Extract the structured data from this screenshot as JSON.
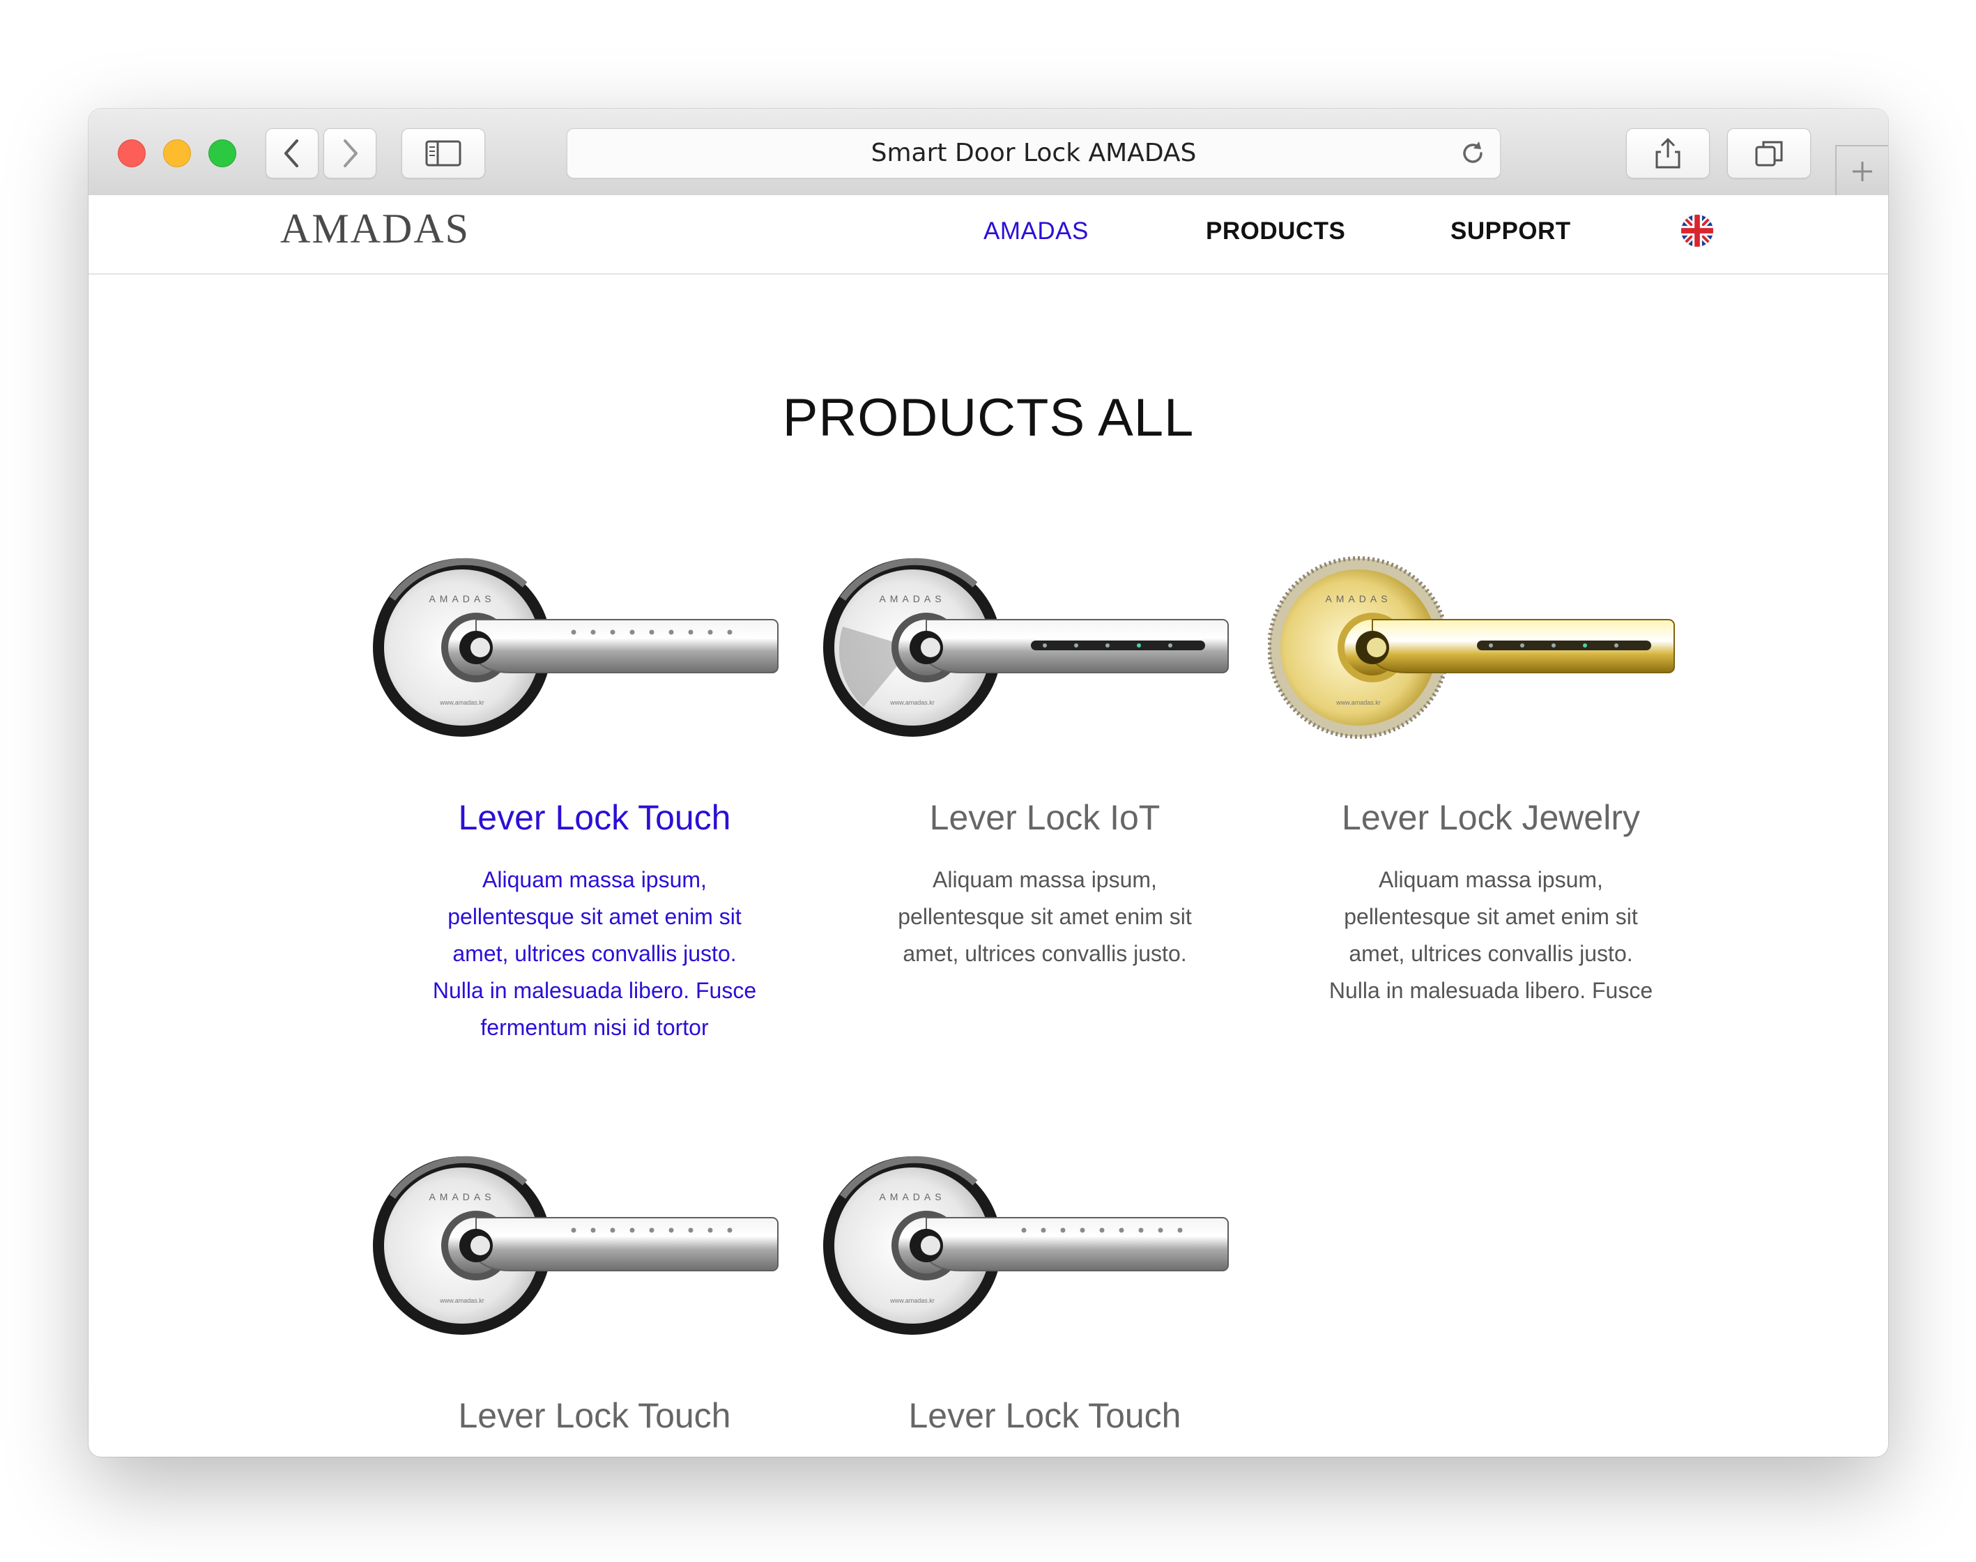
{
  "browser": {
    "address_title": "Smart Door Lock AMADAS"
  },
  "site": {
    "logo": "AMADAS",
    "nav": [
      {
        "label": "AMADAS",
        "active": true
      },
      {
        "label": "PRODUCTS",
        "active": false
      },
      {
        "label": "SUPPORT",
        "active": false
      }
    ],
    "language_icon": "uk-flag-icon"
  },
  "page": {
    "heading": "PRODUCTS ALL"
  },
  "products": [
    {
      "title": "Lever Lock Touch",
      "variant": "touch",
      "highlighted": true,
      "desc": [
        "Aliquam massa ipsum,",
        "pellentesque sit amet enim sit",
        "amet, ultrices convallis justo.",
        "Nulla in malesuada libero. Fusce",
        "fermentum nisi id tortor"
      ]
    },
    {
      "title": "Lever Lock IoT",
      "variant": "iot",
      "highlighted": false,
      "desc": [
        "Aliquam massa ipsum,",
        "pellentesque sit amet enim sit",
        "amet, ultrices convallis justo."
      ]
    },
    {
      "title": "Lever Lock Jewelry",
      "variant": "jewelry",
      "highlighted": false,
      "desc": [
        "Aliquam massa ipsum,",
        "pellentesque sit amet enim sit",
        "amet, ultrices convallis justo.",
        "Nulla in malesuada libero. Fusce"
      ]
    },
    {
      "title": "Lever Lock Touch",
      "variant": "touch",
      "highlighted": false,
      "desc": []
    },
    {
      "title": "Lever Lock Touch",
      "variant": "touch-plain",
      "highlighted": false,
      "desc": []
    }
  ],
  "colors": {
    "accent": "#2a0fd6",
    "traffic_red": "#fc5f57",
    "traffic_yellow": "#fdbc2e",
    "traffic_green": "#2cc841"
  }
}
